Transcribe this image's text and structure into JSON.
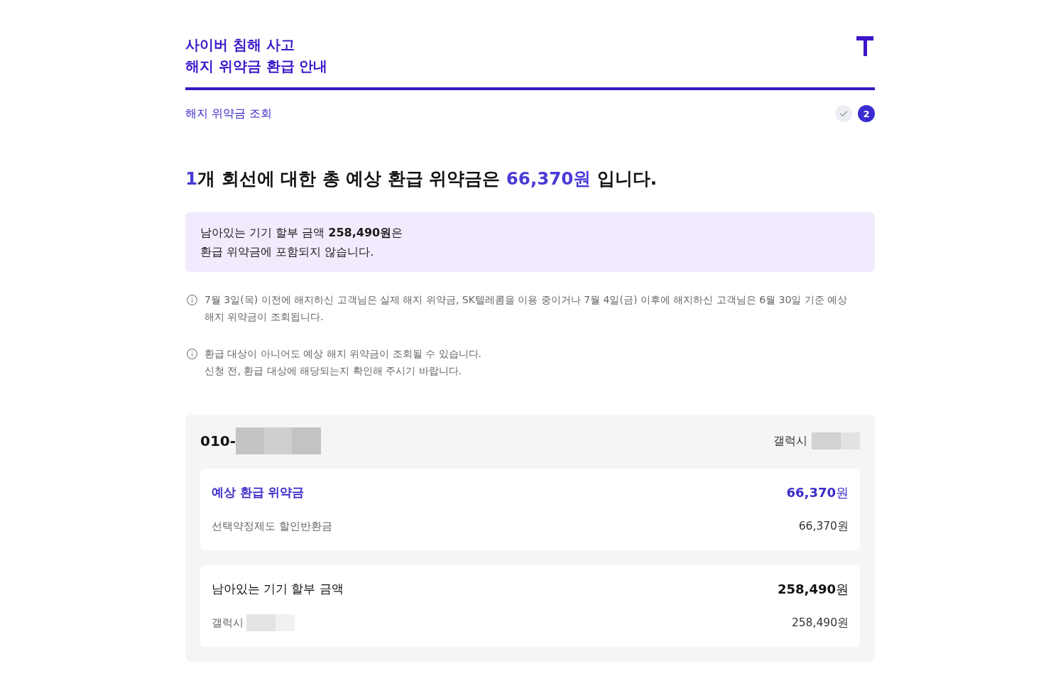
{
  "header": {
    "title_lines": [
      "사이버 침해 사고",
      "해지 위약금 환급 안내"
    ]
  },
  "steps_bar": {
    "label": "해지 위약금 조회",
    "steps": [
      {
        "completed": true,
        "current": false
      },
      {
        "completed": false,
        "current": true,
        "label": "2"
      }
    ]
  },
  "headline": [
    {
      "text": "1",
      "highlight": true
    },
    {
      "text": "개 회선에 대한 총 예상 환급 위약금은 ",
      "highlight": false
    },
    {
      "text": "66,370원",
      "highlight": true
    },
    {
      "text": " 입니다.",
      "highlight": false
    }
  ],
  "notice": {
    "lines": [
      "남아있는 기기 할부 금액 **258,490원**은",
      "환급 위약금에 포함되지 않습니다."
    ]
  },
  "notes": [
    {
      "lines": [
        "7월 3일(목) 이전에 해지하신 고객님은 실제 해지 위약금, SK텔레콤을 이용 중이거나 7월 4일(금) 이후에 해지하신 고객님은 6월 30일 기준 예상",
        "해지 위약금이 조회됩니다."
      ]
    },
    {
      "lines": [
        "환급 대상이 아니어도 예상 해지 위약금이 조회될 수 있습니다.",
        "신청 전, 환급 대상에 해당되는지 확인해 주시기 바랍니다."
      ]
    }
  ],
  "line_card": {
    "phone": "010-",
    "phone_redacted": true,
    "device": "갤럭시",
    "device_redacted": true,
    "sections": [
      {
        "title": "예상 환급 위약금",
        "amount": "**66,370**원",
        "highlight": true,
        "items": [
          {
            "label": "선택약정제도 할인반환금",
            "value": "66,370원"
          }
        ]
      },
      {
        "title": "남아있는 기기 할부 금액",
        "amount": "**258,490**원",
        "highlight": false,
        "items": [
          {
            "label": "갤럭시",
            "redacted": true,
            "value": "258,490원"
          }
        ]
      }
    ]
  }
}
